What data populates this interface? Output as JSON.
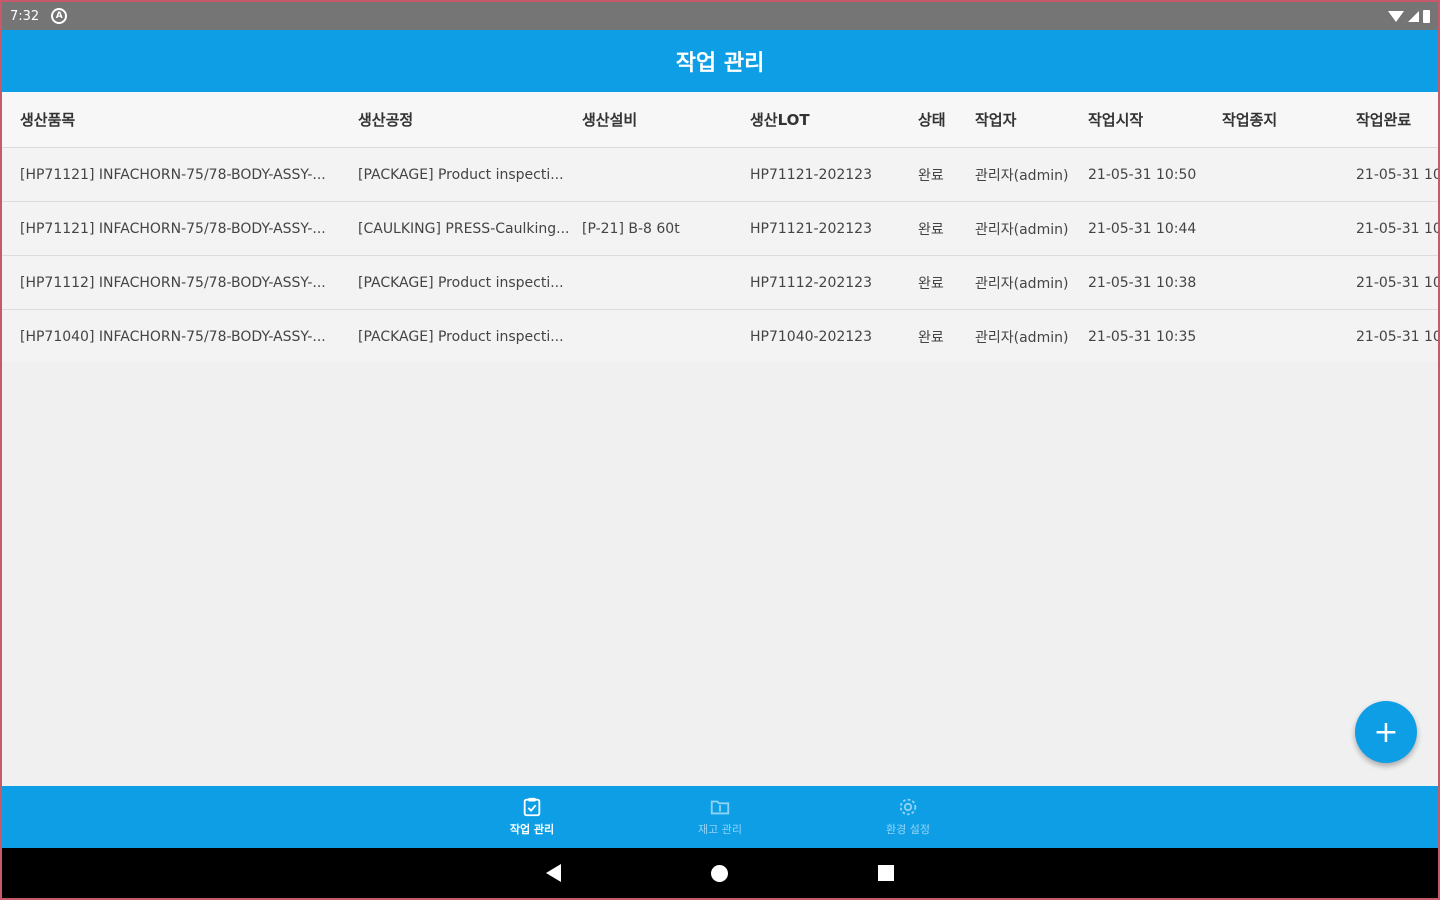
{
  "status_bar": {
    "time": "7:32",
    "badge": "A"
  },
  "app_bar": {
    "title": "작업 관리"
  },
  "table": {
    "headers": [
      "생산품목",
      "생산공정",
      "생산설비",
      "생산LOT",
      "상태",
      "작업자",
      "작업시작",
      "작업종지",
      "작업완료"
    ],
    "rows": [
      [
        "[HP71121] INFACHORN-75/78-BODY-ASSY-...",
        "[PACKAGE] Product inspecti...",
        "",
        "HP71121-202123",
        "완료",
        "관리자(admin)",
        "21-05-31 10:50",
        "",
        "21-05-31 10"
      ],
      [
        "[HP71121] INFACHORN-75/78-BODY-ASSY-...",
        "[CAULKING] PRESS-Caulking...",
        "[P-21] B-8 60t",
        "HP71121-202123",
        "완료",
        "관리자(admin)",
        "21-05-31 10:44",
        "",
        "21-05-31 10"
      ],
      [
        "[HP71112] INFACHORN-75/78-BODY-ASSY-...",
        "[PACKAGE] Product inspecti...",
        "",
        "HP71112-202123",
        "완료",
        "관리자(admin)",
        "21-05-31 10:38",
        "",
        "21-05-31 10"
      ],
      [
        "[HP71040] INFACHORN-75/78-BODY-ASSY-...",
        "[PACKAGE] Product inspecti...",
        "",
        "HP71040-202123",
        "완료",
        "관리자(admin)",
        "21-05-31 10:35",
        "",
        "21-05-31 10"
      ]
    ]
  },
  "fab": {
    "label": "+"
  },
  "bottom_nav": {
    "items": [
      {
        "label": "작업 관리",
        "icon": "clipboard-check-icon",
        "active": true
      },
      {
        "label": "재고 관리",
        "icon": "folder-icon",
        "active": false
      },
      {
        "label": "환경 설정",
        "icon": "gear-icon",
        "active": false
      }
    ]
  },
  "colors": {
    "primary": "#0d9ee6",
    "status_bar": "#757575",
    "background": "#f0f0f0"
  }
}
